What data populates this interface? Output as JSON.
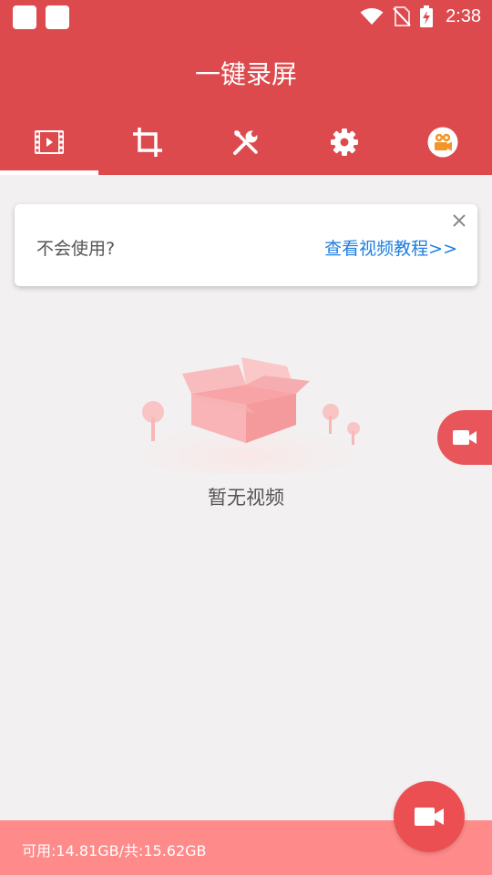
{
  "status_bar": {
    "time": "2:38",
    "icons": [
      "notification-square-icon",
      "notification-square-icon",
      "wifi-icon",
      "no-sim-icon",
      "battery-charging-icon"
    ]
  },
  "app": {
    "title": "一键录屏",
    "colors": {
      "primary": "#dd4a4e",
      "accent": "#ec4f52",
      "link": "#1e7ee0",
      "footer": "#ff8a8a"
    }
  },
  "tabs": [
    {
      "icon": "video-film-icon",
      "selected": true
    },
    {
      "icon": "crop-icon",
      "selected": false
    },
    {
      "icon": "tools-icon",
      "selected": false
    },
    {
      "icon": "settings-gear-icon",
      "selected": false
    },
    {
      "icon": "video-camera-badge-icon",
      "selected": false
    }
  ],
  "help_card": {
    "question": "不会使用?",
    "link": "查看视频教程>>"
  },
  "empty_state": {
    "message": "暂无视频",
    "illustration": "empty-box-icon"
  },
  "footer": {
    "storage": "可用:14.81GB/共:15.62GB"
  },
  "buttons": {
    "floating_record": "video-camera-icon",
    "record_fab": "video-camera-icon"
  }
}
